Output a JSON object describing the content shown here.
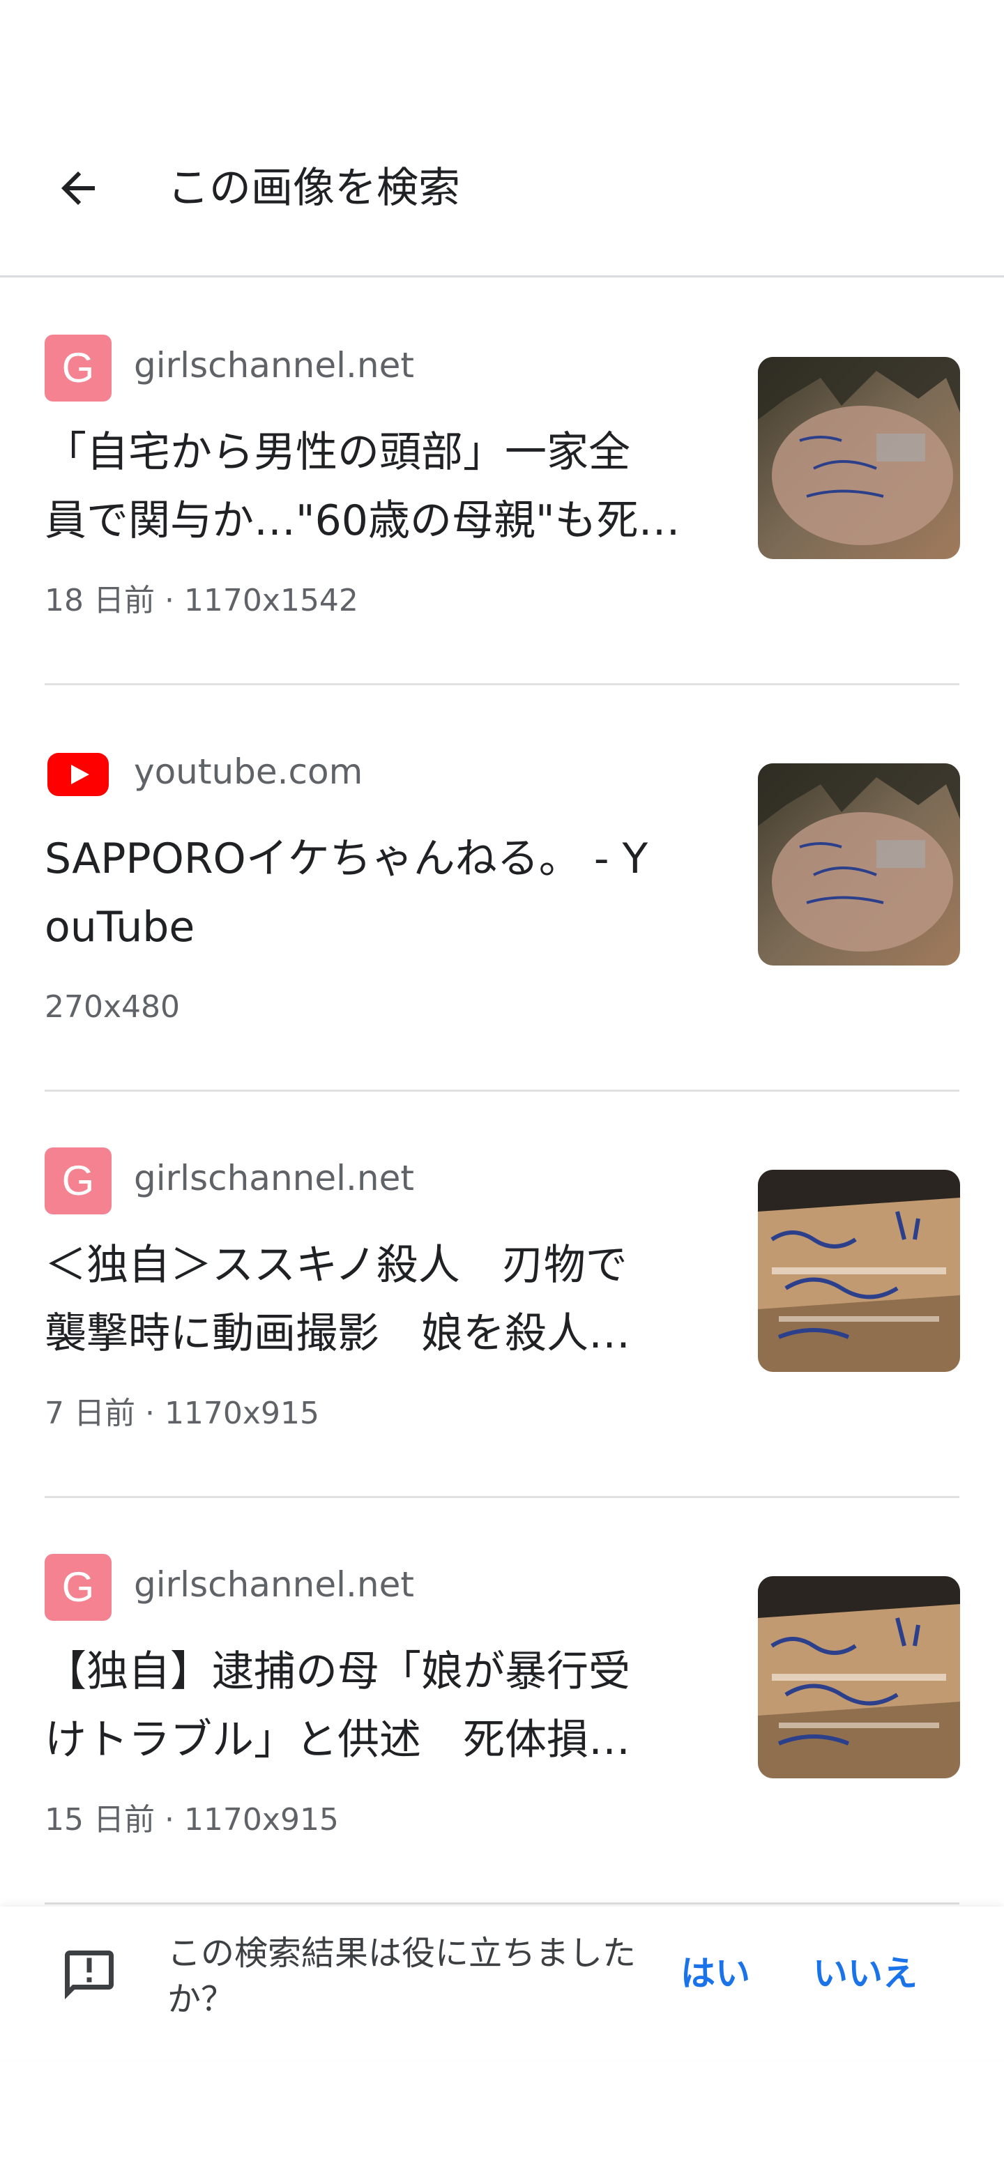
{
  "header": {
    "title": "この画像を検索",
    "back_icon": "arrow-left-icon"
  },
  "results": [
    {
      "source": "girlschannel.net",
      "favicon": "girlschannel-g-icon",
      "favicon_letter": "G",
      "title_lines": [
        "「自宅から男性の頭部」一家全",
        "員で関与か…\"60歳の母親\"も死…"
      ],
      "meta": "18 日前 · 1170x1542"
    },
    {
      "source": "youtube.com",
      "favicon": "youtube-play-icon",
      "favicon_letter": "",
      "title_lines": [
        "SAPPOROイケちゃんねる。 - Y",
        "ouTube"
      ],
      "meta": "270x480"
    },
    {
      "source": "girlschannel.net",
      "favicon": "girlschannel-g-icon",
      "favicon_letter": "G",
      "title_lines": [
        "＜独自＞ススキノ殺人　刃物で",
        "襲撃時に動画撮影　娘を殺人…"
      ],
      "meta": "7 日前 · 1170x915"
    },
    {
      "source": "girlschannel.net",
      "favicon": "girlschannel-g-icon",
      "favicon_letter": "G",
      "title_lines": [
        "【独自】逮捕の母「娘が暴行受",
        "けトラブル」と供述　死体損…"
      ],
      "meta": "15 日前 · 1170x915"
    }
  ],
  "feedback": {
    "question": "この検索結果は役に立ちましたか？",
    "yes_label": "はい",
    "no_label": "いいえ",
    "icon": "feedback-icon"
  },
  "colors": {
    "accent": "#1a73e8",
    "girlschannel": "#f48291",
    "youtube": "#ff0000"
  }
}
